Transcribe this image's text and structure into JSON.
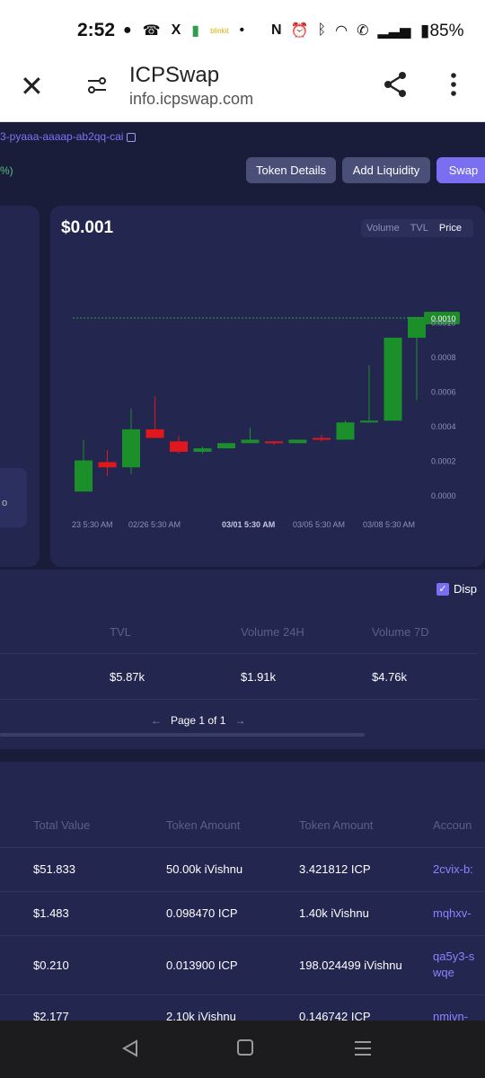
{
  "status_bar": {
    "time": "2:52",
    "battery": "85%",
    "app_label": "blinkit"
  },
  "browser": {
    "title": "ICPSwap",
    "url": "info.icpswap.com"
  },
  "page": {
    "address": "3-pyaaa-aaaap-ab2qq-cai",
    "percent": "%)",
    "buttons": {
      "token_details": "Token Details",
      "add_liquidity": "Add Liquidity",
      "swap": "Swap"
    },
    "price": "$0.001",
    "segments": [
      "Volume",
      "TVL",
      "Price"
    ],
    "active_segment": "Price",
    "mini_card_text": "o"
  },
  "chart_data": {
    "type": "candlestick",
    "current_price_label": "0.0010",
    "y_ticks": [
      "0.0010",
      "0.0008",
      "0.0006",
      "0.0004",
      "0.0002",
      "0.0000"
    ],
    "x_ticks": [
      "23 5:30 AM",
      "02/26 5:30 AM",
      "03/01 5:30 AM",
      "03/05 5:30 AM",
      "03/08 5:30 AM"
    ],
    "ylim": [
      0,
      0.00105
    ],
    "candles": [
      {
        "open": 2e-05,
        "close": 0.0002,
        "high": 0.00032,
        "low": 2e-05
      },
      {
        "open": 0.00019,
        "close": 0.00016,
        "high": 0.00026,
        "low": 0.00011
      },
      {
        "open": 0.00016,
        "close": 0.00038,
        "high": 0.0005,
        "low": 0.00012
      },
      {
        "open": 0.00038,
        "close": 0.00033,
        "high": 0.00057,
        "low": 0.00033
      },
      {
        "open": 0.00031,
        "close": 0.00025,
        "high": 0.00034,
        "low": 0.00024
      },
      {
        "open": 0.00025,
        "close": 0.00027,
        "high": 0.00028,
        "low": 0.00024
      },
      {
        "open": 0.00027,
        "close": 0.0003,
        "high": 0.0003,
        "low": 0.00027
      },
      {
        "open": 0.0003,
        "close": 0.00032,
        "high": 0.00039,
        "low": 0.0003
      },
      {
        "open": 0.00031,
        "close": 0.0003,
        "high": 0.00031,
        "low": 0.00029
      },
      {
        "open": 0.0003,
        "close": 0.00032,
        "high": 0.00032,
        "low": 0.0003
      },
      {
        "open": 0.00033,
        "close": 0.00032,
        "high": 0.00035,
        "low": 0.00031
      },
      {
        "open": 0.00032,
        "close": 0.00042,
        "high": 0.00043,
        "low": 0.00032
      },
      {
        "open": 0.00042,
        "close": 0.00043,
        "high": 0.00075,
        "low": 0.00042
      },
      {
        "open": 0.00043,
        "close": 0.00091,
        "high": 0.00091,
        "low": 0.00043
      },
      {
        "open": 0.00091,
        "close": 0.00103,
        "high": 0.00103,
        "low": 0.00055
      }
    ]
  },
  "summary_table": {
    "headers": [
      "TVL",
      "Volume 24H",
      "Volume 7D"
    ],
    "values": [
      "$5.87k",
      "$1.91k",
      "$4.76k"
    ],
    "checkbox_label": "Disp",
    "pager": {
      "text": "Page 1 of 1",
      "prev": "←",
      "next": "→"
    }
  },
  "tx_table": {
    "headers": [
      "Total Value",
      "Token Amount",
      "Token Amount",
      "Accoun"
    ],
    "rows": [
      {
        "total": "$51.833",
        "amount1": "50.00k iVishnu",
        "amount2": "3.421812 ICP",
        "account": "2cvix-b:"
      },
      {
        "total": "$1.483",
        "amount1": "0.098470 ICP",
        "amount2": "1.40k iVishnu",
        "account": "mqhxv-"
      },
      {
        "total": "$0.210",
        "amount1": "0.013900 ICP",
        "amount2": "198.024499 iVishnu",
        "account": "qa5y3-s",
        "account2": "wqe"
      },
      {
        "total": "$2.177",
        "amount1": "2.10k iVishnu",
        "amount2": "0.146742 ICP",
        "account": "nmivn-"
      }
    ]
  }
}
